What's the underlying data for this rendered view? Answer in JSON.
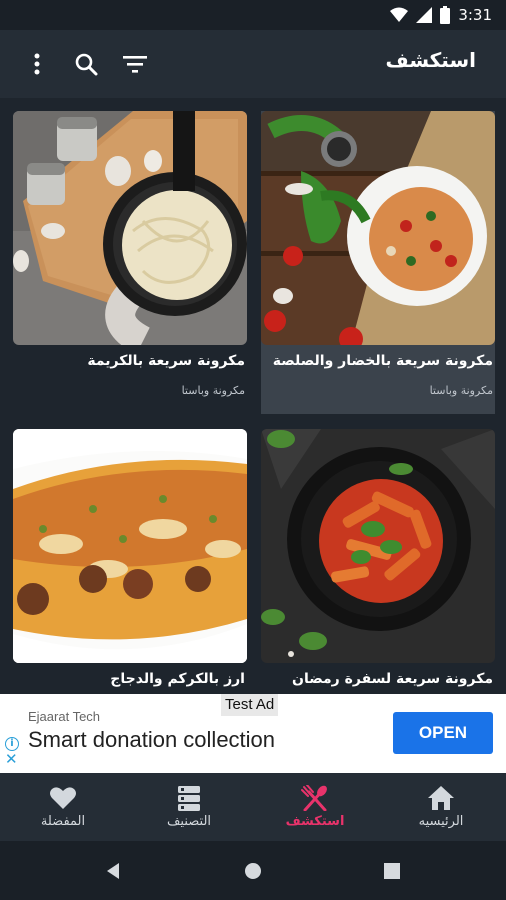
{
  "status_bar": {
    "time": "3:31"
  },
  "toolbar": {
    "title": "استكشف",
    "icons": [
      "more-vert-icon",
      "search-icon",
      "filter-icon"
    ]
  },
  "recipes": [
    {
      "title": "مكرونة سريعة بالكريمة",
      "category": "مكرونة وباستا",
      "image": "creamy-pasta-photo"
    },
    {
      "title": "مكرونة سريعة بالخضار والصلصة",
      "category": "مكرونة وباستا",
      "image": "vegetable-pasta-photo"
    },
    {
      "title": "ارز بالكركم والدجاج",
      "category": "",
      "image": "turmeric-rice-chicken-photo"
    },
    {
      "title": "مكرونة سريعة لسفرة رمضان",
      "category": "",
      "image": "penne-tomato-photo"
    }
  ],
  "ad": {
    "label": "Test Ad",
    "advertiser": "Ejaarat Tech",
    "headline": "Smart donation collection",
    "cta": "OPEN"
  },
  "bottom_nav": {
    "items": [
      {
        "label": "المفضلة",
        "icon": "heart-icon",
        "active": false
      },
      {
        "label": "التصنيف",
        "icon": "categories-icon",
        "active": false
      },
      {
        "label": "استكشف",
        "icon": "fork-knife-icon",
        "active": true
      },
      {
        "label": "الرئيسيه",
        "icon": "home-icon",
        "active": false
      }
    ]
  },
  "colors": {
    "accent": "#e8336b",
    "background": "#1e252d",
    "toolbar": "#252d36",
    "ad_button": "#1a73e8"
  }
}
